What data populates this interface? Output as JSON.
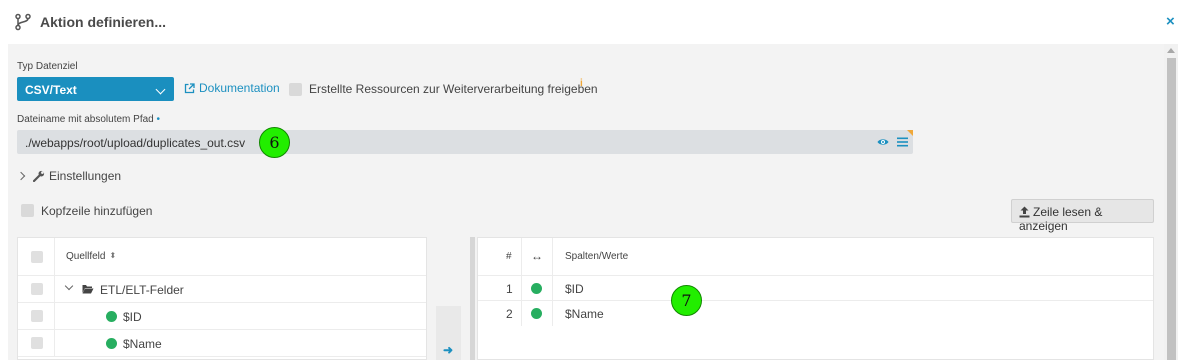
{
  "header": {
    "title": "Aktion definieren...",
    "close_label": "×"
  },
  "form": {
    "typ_label": "Typ Datenziel",
    "typ_value": "CSV/Text",
    "doc_link": "Dokumentation",
    "share_label": "Erstellte Ressourcen zur Weiterverarbeitung freigeben",
    "share_info": "i",
    "file_label": "Dateiname mit absolutem Pfad",
    "file_required": "•",
    "file_value": "./webapps/root/upload/duplicates_out.csv",
    "settings_label": "Einstellungen",
    "header_row_label": "Kopfzeile hinzufügen",
    "read_button": "Zeile lesen & anzeigen"
  },
  "badges": [
    "6",
    "7"
  ],
  "left_table": {
    "header": "Quellfeld",
    "folder": "ETL/ELT-Felder",
    "fields": [
      "$ID",
      "$Name"
    ]
  },
  "transfer_arrow": "➜",
  "right_table": {
    "col_num": "#",
    "col_arrow": "↔",
    "col_values": "Spalten/Werte",
    "rows": [
      {
        "num": "1",
        "value": "$ID"
      },
      {
        "num": "2",
        "value": "$Name"
      }
    ]
  },
  "colors": {
    "accent": "#1a8fbf",
    "status_green": "#27ae60",
    "badge_green": "#22ee00",
    "info_orange": "#f0a83a"
  }
}
